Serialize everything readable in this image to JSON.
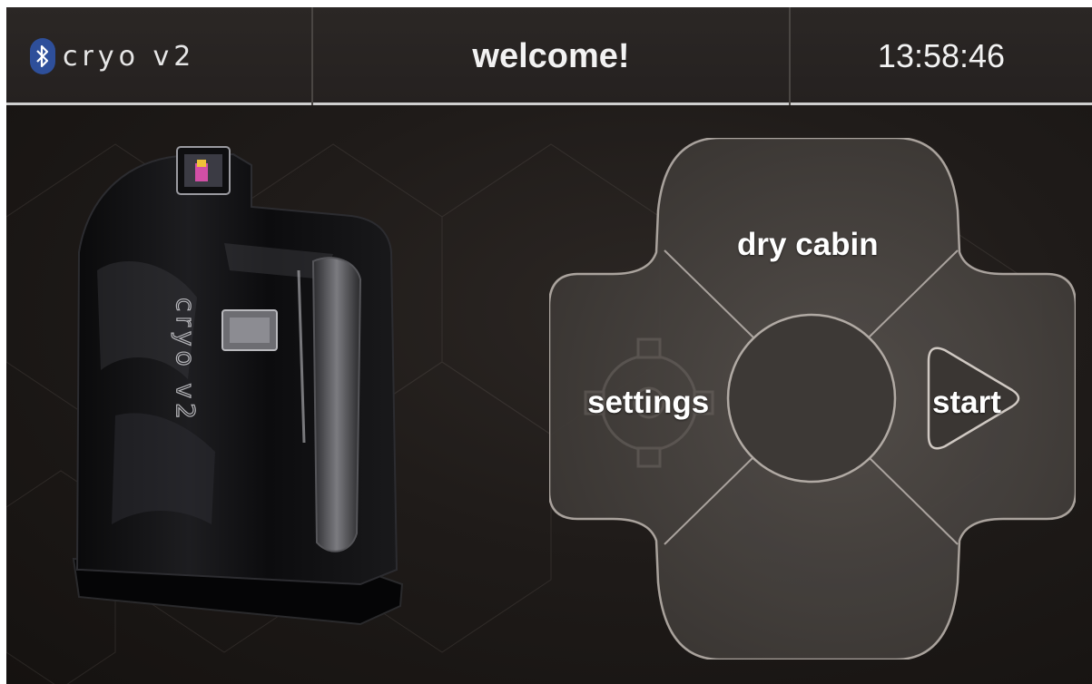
{
  "header": {
    "brand": "cryo v2",
    "title": "welcome!",
    "clock": "13:58:46"
  },
  "icons": {
    "bluetooth": "bluetooth-icon",
    "settings": "gear-icon",
    "start": "play-triangle-icon"
  },
  "pad": {
    "top_label": "dry cabin",
    "left_label": "settings",
    "right_label": "start",
    "center_label": ""
  },
  "product": {
    "side_lettering": "cryo v2"
  },
  "colors": {
    "background": "#1f1b19",
    "header": "#2b2725",
    "header_rule": "#cfcfcf",
    "bluetooth": "#2e4f9a",
    "pad_fill": "#4a4542",
    "pad_stroke": "#a9a29d",
    "text": "#ffffff"
  }
}
